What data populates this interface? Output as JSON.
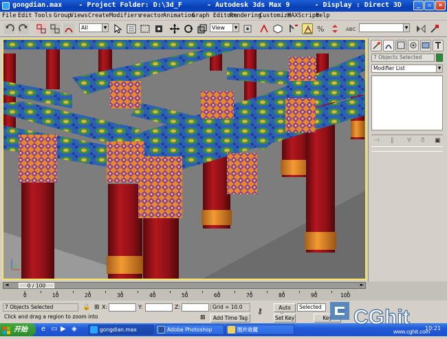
{
  "window": {
    "title": "gongdian.max    - Project Folder: D:\\3d_F      - Autodesk 3ds Max 9      - Display : Direct 3D"
  },
  "menu": [
    "File",
    "Edit",
    "Tools",
    "Group",
    "Views",
    "Create",
    "Modifiers",
    "reactor",
    "Animation",
    "Graph Editors",
    "Rendering",
    "Customize",
    "MAXScript",
    "Help"
  ],
  "toolbar": {
    "selection_filter": "All",
    "reference_coord": "View",
    "named_selection": ""
  },
  "command_panel": {
    "selection_info": "7 Objects Selected",
    "modifier_list": "Modifier List",
    "color_swatch": "#1f8f2f"
  },
  "timeline": {
    "frame_counter": "0 / 100",
    "ticks": [
      "0",
      "10",
      "20",
      "30",
      "40",
      "50",
      "60",
      "70",
      "80",
      "90",
      "100"
    ]
  },
  "status": {
    "selection": "7 Objects Selected",
    "prompt": "Click and drag a region to zoom into",
    "x_label": "X:",
    "y_label": "Y:",
    "z_label": "Z:",
    "grid": "Grid = 10.0",
    "auto_key": "Auto Key",
    "set_key": "Set Key",
    "key_mode": "Selected",
    "key_filters": "Key Filters...",
    "add_time_tag": "Add Time Tag"
  },
  "taskbar": {
    "start": "开始",
    "tasks": [
      "gongdian.max",
      "Adobe Photoshop",
      "图片收藏"
    ],
    "clock": "10:21"
  },
  "watermark": {
    "brand": "CGhit",
    "url": "www.cghit.com"
  },
  "colors": {
    "viewport_border": "#f7e463",
    "column_red": "#a3141a",
    "beam_blue": "#2a5ab8",
    "bracket_orange": "#e8802a"
  }
}
